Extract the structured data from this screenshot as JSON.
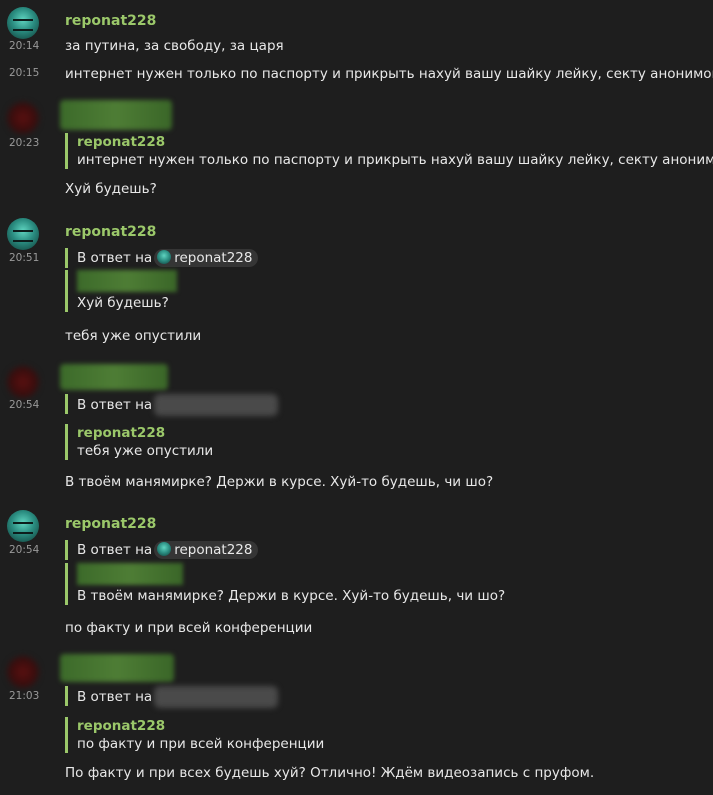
{
  "m1": {
    "name": "reponat228",
    "time1": "20:14",
    "text1": "за путина, за свободу, за царя",
    "time2": "20:15",
    "text2": "интернет нужен только по паспорту и прикрыть нахуй вашу шайку лейку, секту анонимов"
  },
  "m2": {
    "time": "20:23",
    "quote_name": "reponat228",
    "quote_text": "интернет нужен только по паспорту и прикрыть нахуй вашу шайку лейку, секту анонимов",
    "text": "Хуй будешь?"
  },
  "m3": {
    "name": "reponat228",
    "time": "20:51",
    "reply_prefix": "В ответ на",
    "reply_user": "reponat228",
    "quote_text": "Хуй будешь?",
    "text": "тебя уже опустили"
  },
  "m4": {
    "time": "20:54",
    "reply_prefix": "В ответ на",
    "quote_name": "reponat228",
    "quote_text": "тебя уже опустили",
    "text": "В твоём манямирке? Держи в курсе. Хуй-то будешь, чи шо?"
  },
  "m5": {
    "name": "reponat228",
    "time": "20:54",
    "reply_prefix": "В ответ на",
    "reply_user": "reponat228",
    "quote_text": "В твоём манямирке? Держи в курсе. Хуй-то будешь, чи шо?",
    "text": "по факту и при всей конференции"
  },
  "m6": {
    "time": "21:03",
    "reply_prefix": "В ответ на",
    "quote_name": "reponat228",
    "quote_text": "по факту и при всей конференции",
    "text": "По факту и при всех будешь хуй? Отлично! Ждём видеозапись с пруфом."
  }
}
